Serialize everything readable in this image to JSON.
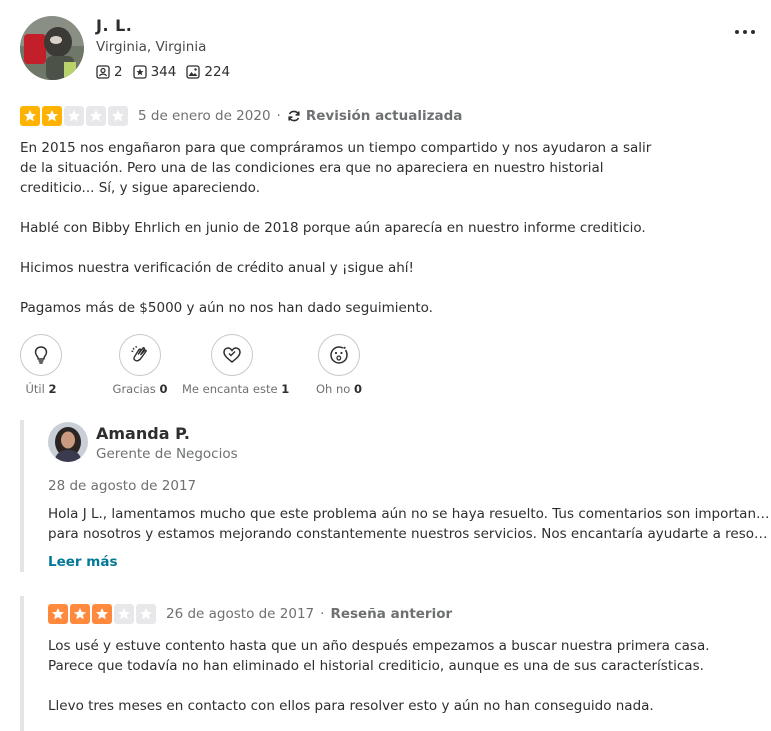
{
  "reviewer": {
    "name": "J. L.",
    "location": "Virginia, Virginia",
    "friends": "2",
    "reviews": "344",
    "photos": "224"
  },
  "review": {
    "rating": 2,
    "date": "5 de enero de 2020",
    "separator": "·",
    "updated_label": "Revisión actualizada",
    "paragraphs": [
      "En 2015 nos engañaron para que compráramos un tiempo compartido y nos ayudaron a salir de la situación. Pero una de las condiciones era que no apareciera en nuestro historial crediticio... Sí, y sigue apareciendo.",
      "Hablé con Bibby Ehrlich en junio de 2018 porque aún aparecía en nuestro informe crediticio.",
      "Hicimos nuestra verificación de crédito anual y ¡sigue ahí!",
      "Pagamos más de $5000 y aún no nos han dado seguimiento."
    ]
  },
  "reactions": [
    {
      "label": "Útil",
      "count": "2",
      "icon": "lightbulb-icon"
    },
    {
      "label": "Gracias",
      "count": "0",
      "icon": "clapping-hands-icon"
    },
    {
      "label": "Me encanta este",
      "count": "1",
      "icon": "heart-icon"
    },
    {
      "label": "Oh no",
      "count": "0",
      "icon": "cookie-oh-no-icon"
    }
  ],
  "owner_response": {
    "name": "Amanda P.",
    "role": "Gerente de Negocios",
    "date": "28 de agosto de 2017",
    "line1": "Hola J L., lamentamos mucho que este problema aún no se haya resuelto. Tus comentarios son importantes",
    "line2": "para nosotros y estamos mejorando constantemente nuestros servicios. Nos encantaría ayudarte a resolver...",
    "read_more": "Leer más"
  },
  "previous_review": {
    "rating": 3,
    "date": "26 de agosto de 2017",
    "separator": "·",
    "label": "Reseña anterior",
    "paragraphs": [
      "Los usé y estuve contento hasta que un año después empezamos a buscar nuestra primera casa. Parece que todavía no han eliminado el historial crediticio, aunque es una de sus características.",
      "Llevo tres meses en contacto con ellos para resolver esto y aún no han conseguido nada."
    ]
  },
  "colors": {
    "star_two": "#ffb300",
    "star_three": "#ff8a3d",
    "star_off": "#e8e8ea",
    "link": "#027a97"
  }
}
